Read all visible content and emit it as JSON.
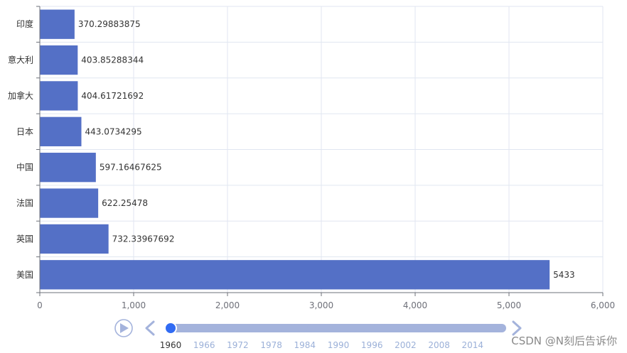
{
  "chart_data": {
    "type": "bar",
    "orientation": "horizontal",
    "categories": [
      "印度",
      "意大利",
      "加拿大",
      "日本",
      "中国",
      "法国",
      "英国",
      "美国"
    ],
    "values": [
      370.29883875,
      403.85288344,
      404.61721692,
      443.0734295,
      597.16467625,
      622.25478,
      732.33967692,
      5433
    ],
    "value_labels": [
      "370.29883875",
      "403.85288344",
      "404.61721692",
      "443.0734295",
      "597.16467625",
      "622.25478",
      "732.33967692",
      "5433"
    ],
    "xlim": [
      0,
      6000
    ],
    "x_ticks": [
      0,
      1000,
      2000,
      3000,
      4000,
      5000,
      6000
    ],
    "x_tick_labels": [
      "0",
      "1,000",
      "2,000",
      "3,000",
      "4,000",
      "5,000",
      "6,000"
    ],
    "grid": true,
    "bar_color": "#5470c6"
  },
  "timeline": {
    "years": [
      "1960",
      "1966",
      "1972",
      "1978",
      "1984",
      "1990",
      "1996",
      "2002",
      "2008",
      "2014"
    ],
    "current": "1960",
    "play_icon": "play-icon",
    "prev_icon": "chevron-left-icon",
    "next_icon": "chevron-right-icon",
    "accent_color": "#a4b3dc",
    "active_color": "#316bf3"
  },
  "watermark": "CSDN @N刻后告诉你"
}
